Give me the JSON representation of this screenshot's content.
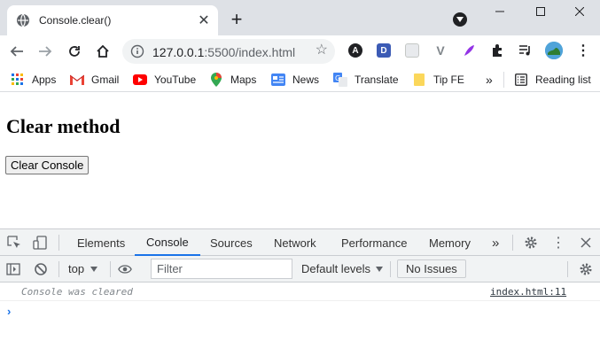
{
  "tab": {
    "title": "Console.clear()",
    "favicon": "globe-icon"
  },
  "window_controls": {
    "minimize": "minimize-icon",
    "maximize": "maximize-icon",
    "close": "close-icon"
  },
  "omnibox": {
    "host": "127.0.0.1",
    "port_path": ":5500/index.html"
  },
  "bookmarks": {
    "items": [
      {
        "label": "Apps",
        "icon": "apps-grid-icon"
      },
      {
        "label": "Gmail",
        "icon": "gmail-icon"
      },
      {
        "label": "YouTube",
        "icon": "youtube-icon"
      },
      {
        "label": "Maps",
        "icon": "maps-pin-icon"
      },
      {
        "label": "News",
        "icon": "news-icon"
      },
      {
        "label": "Translate",
        "icon": "translate-icon"
      },
      {
        "label": "Tip FE",
        "icon": "folder-icon"
      }
    ],
    "overflow": "»",
    "reading_list": "Reading list"
  },
  "page": {
    "heading": "Clear method",
    "button_label": "Clear Console"
  },
  "devtools": {
    "tabs": [
      "Elements",
      "Console",
      "Sources",
      "Network",
      "Performance",
      "Memory"
    ],
    "more_tabs": "»",
    "context": "top",
    "filter_placeholder": "Filter",
    "levels": "Default levels",
    "issues": "No Issues",
    "message": "Console was cleared",
    "message_source": "index.html:11",
    "prompt": "›"
  },
  "colors": {
    "accent": "#1a73e8",
    "tabstrip": "#dee1e6",
    "devtools_bar": "#f1f3f4"
  }
}
